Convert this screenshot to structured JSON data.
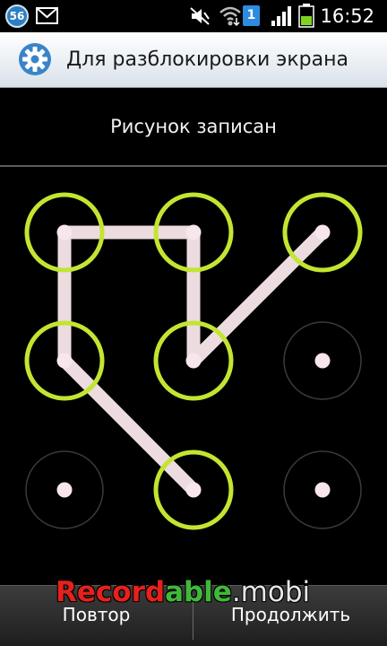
{
  "status_bar": {
    "notification_count": "56",
    "sim_label": "1",
    "time": "16:52",
    "icons": [
      "mail-icon",
      "mute-icon",
      "wifi-icon",
      "signal-icon",
      "battery-icon"
    ]
  },
  "title_bar": {
    "title": "Для разблокировки экрана",
    "icon": "gear-icon"
  },
  "header": {
    "text": "Рисунок записан"
  },
  "pattern": {
    "grid": [
      3,
      3
    ],
    "sequence": [
      [
        1,
        2
      ],
      [
        0,
        1
      ],
      [
        0,
        0
      ],
      [
        1,
        0
      ],
      [
        1,
        1
      ],
      [
        2,
        0
      ]
    ],
    "colors": {
      "ring_active": "#c3e531",
      "ring_inactive": "#3b3b3b",
      "dot": "#f7e6ec",
      "line": "#ecdce0"
    }
  },
  "buttons": {
    "retry": "Повтор",
    "continue": "Продолжить"
  },
  "watermark": {
    "part1": "Record",
    "part2": "able",
    "part3": ".mobi"
  }
}
